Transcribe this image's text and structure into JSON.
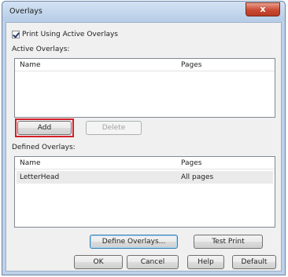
{
  "window": {
    "title": "Overlays",
    "close_glyph": "x"
  },
  "print_using_overlays": {
    "label": "Print Using Active Overlays",
    "checked": true
  },
  "active_overlays": {
    "label": "Active Overlays:",
    "columns": [
      "Name",
      "Pages"
    ],
    "rows": []
  },
  "buttons_active": {
    "add": "Add",
    "delete": "Delete"
  },
  "defined_overlays": {
    "label": "Defined Overlays:",
    "columns": [
      "Name",
      "Pages"
    ],
    "rows": [
      {
        "name": "LetterHead",
        "pages": "All pages"
      }
    ]
  },
  "buttons_defined": {
    "define": "Define Overlays...",
    "test": "Test Print"
  },
  "footer": {
    "ok": "OK",
    "cancel": "Cancel",
    "help": "Help",
    "default": "Default"
  },
  "colors": {
    "title_bar": "#c8dbf0",
    "close_button": "#c94a33",
    "highlight": "#d51f2a",
    "dialog_bg": "#f0f0f0"
  }
}
